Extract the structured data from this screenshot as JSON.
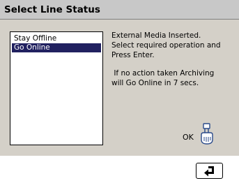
{
  "dialog": {
    "title": "Select Line Status",
    "options": [
      {
        "label": "Stay Offline",
        "selected": false
      },
      {
        "label": "Go Online",
        "selected": true
      }
    ],
    "message_lines": [
      "External Media Inserted.",
      "Select required operation and",
      "Press Enter.",
      "",
      " If no action taken Archiving",
      "will Go Online in 7 secs."
    ],
    "ok_label": "OK",
    "ok_icon": "pointing-hand-icon"
  },
  "footer": {
    "enter_icon": "return-arrow-icon"
  },
  "colors": {
    "dialog_bg": "#d4d0c8",
    "titlebar_bg": "#c8c8c8",
    "selection_bg": "#212160",
    "selection_fg": "#ffffff"
  }
}
